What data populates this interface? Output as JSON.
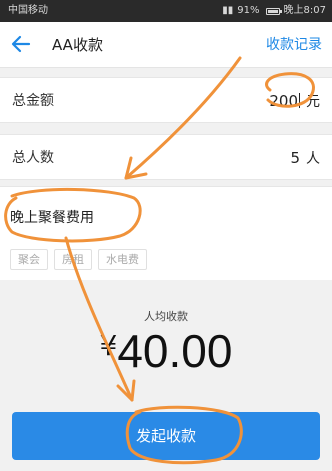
{
  "status_bar": {
    "carrier": "中国移动",
    "battery": "91%",
    "time": "晚上8:07"
  },
  "nav": {
    "back_icon": "arrow-left-icon",
    "title": "AA收款",
    "link": "收款记录",
    "accent": "#1e88e5"
  },
  "form": {
    "total_amount": {
      "label": "总金额",
      "value": "200",
      "unit": "元"
    },
    "total_people": {
      "label": "总人数",
      "value": "5",
      "unit": "人"
    }
  },
  "note": {
    "text": "晚上聚餐费用",
    "tags": [
      "聚会",
      "房租",
      "水电费"
    ]
  },
  "summary": {
    "label": "人均收款",
    "currency": "¥",
    "amount": "40.00"
  },
  "submit": {
    "label": "发起收款",
    "color": "#2a8ae6"
  },
  "annotation": {
    "color": "#f0923a"
  }
}
